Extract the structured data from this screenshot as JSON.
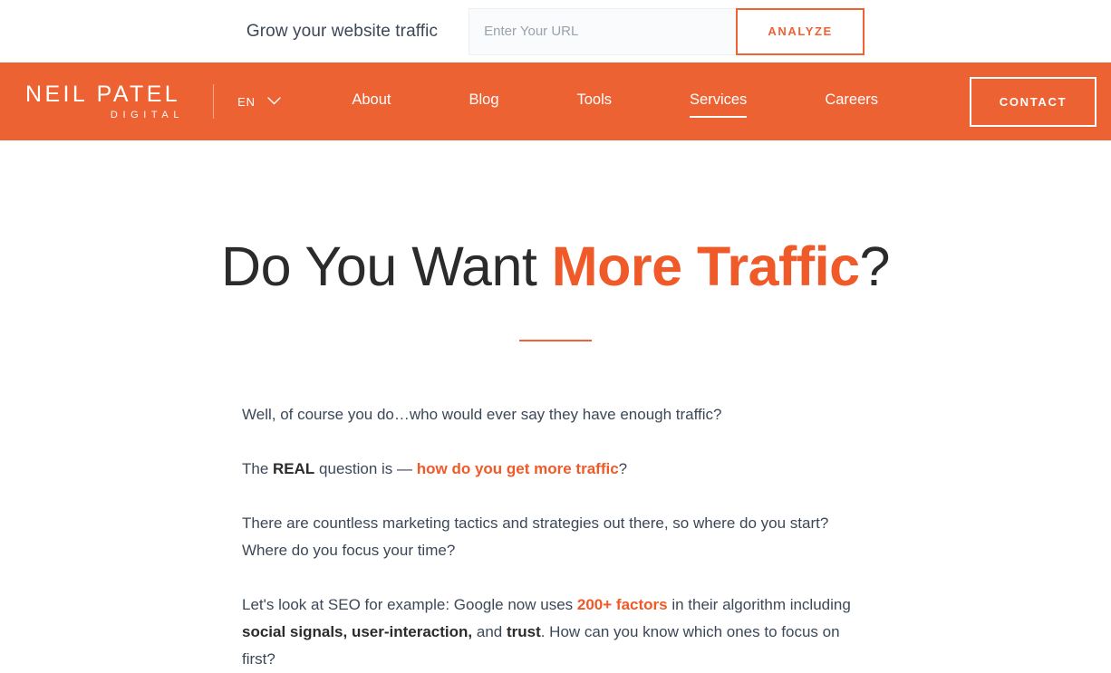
{
  "topbar": {
    "tagline": "Grow your website traffic",
    "url_input_placeholder": "Enter Your URL",
    "url_input_value": "",
    "analyze_label": "ANALYZE"
  },
  "navbar": {
    "logo_main": "NEIL PATEL",
    "logo_sub": "DIGITAL",
    "language": "EN",
    "chevron_icon": "chevron-down-icon",
    "links": [
      {
        "label": "About",
        "active": false
      },
      {
        "label": "Blog",
        "active": false
      },
      {
        "label": "Tools",
        "active": false
      },
      {
        "label": "Services",
        "active": true
      },
      {
        "label": "Careers",
        "active": false
      }
    ],
    "contact_label": "CONTACT"
  },
  "main": {
    "headline_lead": "Do You Want ",
    "headline_accent": "More Traffic",
    "headline_tail": "?",
    "paragraphs": {
      "p1": "Well, of course you do…who would ever say they have enough traffic?",
      "p2_a": "The ",
      "p2_b": "REAL",
      "p2_c": " question is — ",
      "p2_d": "how do you get more traffic",
      "p2_e": "?",
      "p3": "There are countless marketing tactics and strategies out there, so where do you start? Where do you focus your time?",
      "p4_a": "Let's look at SEO for example: Google now uses ",
      "p4_b": "200+ factors",
      "p4_c": " in their algorithm including ",
      "p4_d": "social signals, user-interaction,",
      "p4_e": " and ",
      "p4_f": "trust",
      "p4_g": ". How can you know which ones to focus on first?"
    }
  },
  "colors": {
    "brand_orange": "#ec6233",
    "accent_orange": "#f05a28",
    "body_text": "#3c4858",
    "heading_text": "#2b2b2b",
    "input_bg": "#fafbfc"
  }
}
